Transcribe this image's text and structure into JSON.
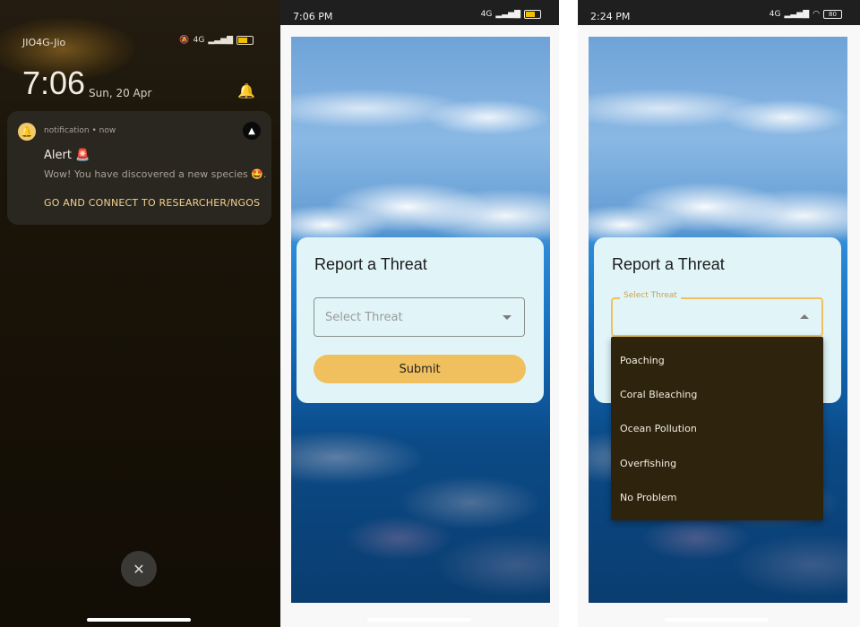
{
  "lockscreen": {
    "carrier": "JIO4G-Jio",
    "time": "7:06",
    "date": "Sun, 20 Apr",
    "notification": {
      "app_name": "notification • now",
      "title": "Alert 🚨",
      "body": "Wow! You have discovered a new species 🤩.",
      "action": "GO AND CONNECT TO RESEARCHER/NGOS"
    },
    "close_glyph": "✕"
  },
  "screen2": {
    "status_time": "7:06 PM",
    "card_title": "Report a Threat",
    "select_placeholder": "Select Threat",
    "submit_label": "Submit"
  },
  "screen3": {
    "status_time": "2:24 PM",
    "status_battery": "80",
    "card_title": "Report a Threat",
    "select_label": "Select Threat",
    "options": [
      "Poaching",
      "Coral Bleaching",
      "Ocean Pollution",
      "Overfishing",
      "No Problem"
    ]
  },
  "status": {
    "battery_left": "44",
    "network": "4G"
  },
  "colors": {
    "accent": "#f0c05e",
    "card_bg": "#e1f5f9",
    "menu_bg": "#2e230d"
  }
}
